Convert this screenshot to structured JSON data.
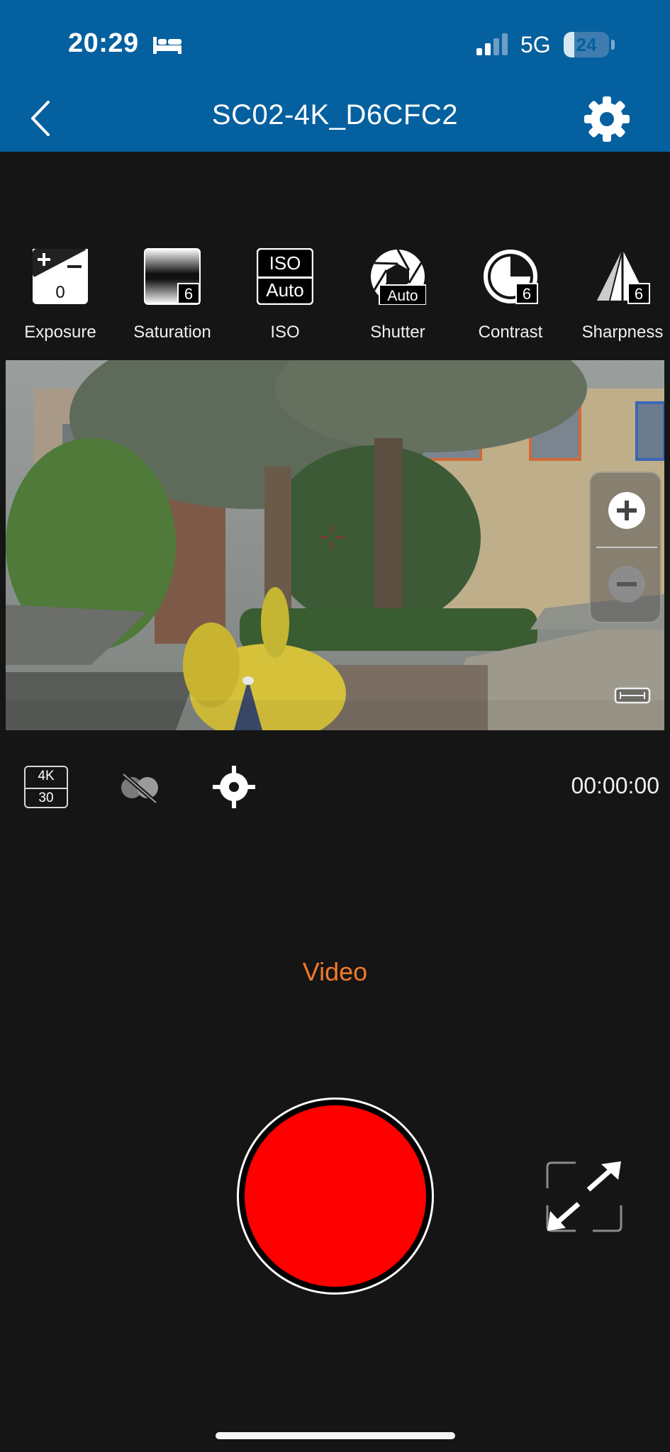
{
  "status_bar": {
    "time": "20:29",
    "sleep_icon": "bed-icon",
    "signal_icon": "signal-bars-icon",
    "network": "5G",
    "battery_level": "24",
    "battery_fraction": 0.24
  },
  "header": {
    "back_icon": "chevron-left-icon",
    "title": "SC02-4K_D6CFC2",
    "settings_icon": "gear-icon",
    "background_color": "#05609F"
  },
  "camera_settings": [
    {
      "label": "Exposure",
      "icon": "exposure-icon",
      "value": "0"
    },
    {
      "label": "Saturation",
      "icon": "saturation-icon",
      "value": "6"
    },
    {
      "label": "ISO",
      "icon": "iso-icon",
      "value": "Auto",
      "icon_text": "ISO"
    },
    {
      "label": "Shutter",
      "icon": "aperture-icon",
      "value": "Auto"
    },
    {
      "label": "Contrast",
      "icon": "contrast-icon",
      "value": "6"
    },
    {
      "label": "Sharpness",
      "icon": "sharpness-icon",
      "value": "6"
    }
  ],
  "preview": {
    "zoom_in_icon": "plus-circle-icon",
    "zoom_out_icon": "minus-circle-icon",
    "aspect_icon": "aspect-ratio-icon",
    "reticle_icon": "crosshair-icon"
  },
  "controls": {
    "resolution": "4K",
    "framerate": "30",
    "filter_icon": "filter-off-icon",
    "target_icon": "target-icon",
    "timer": "00:00:00"
  },
  "mode": {
    "label": "Video",
    "color": "#F07A2C"
  },
  "record": {
    "icon": "record-icon",
    "color": "#FE0000"
  },
  "fullscreen_icon": "expand-arrows-icon"
}
